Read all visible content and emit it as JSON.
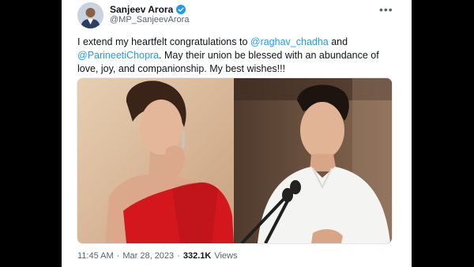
{
  "tweet": {
    "display_name": "Sanjeev Arora",
    "handle": "@MP_SanjeevArora",
    "more_icon": "more-dots-icon",
    "verified_icon": "verified-badge-icon",
    "text_before": "I extend my heartfelt congratulations to ",
    "mention_1": "@raghav_chadha",
    "text_between": " and ",
    "mention_2": "@ParineetiChopra",
    "text_after": ". May their union be blessed with an abundance of love, joy, and companionship. My best wishes!!!",
    "time": "11:45 AM",
    "separator": "·",
    "date": "Mar 28, 2023",
    "views_count": "332.1K",
    "views_label": "Views"
  },
  "colors": {
    "accent": "#1d9bf0",
    "text_primary": "#0f1419",
    "text_secondary": "#536471",
    "dress_red": "#d3171d"
  }
}
